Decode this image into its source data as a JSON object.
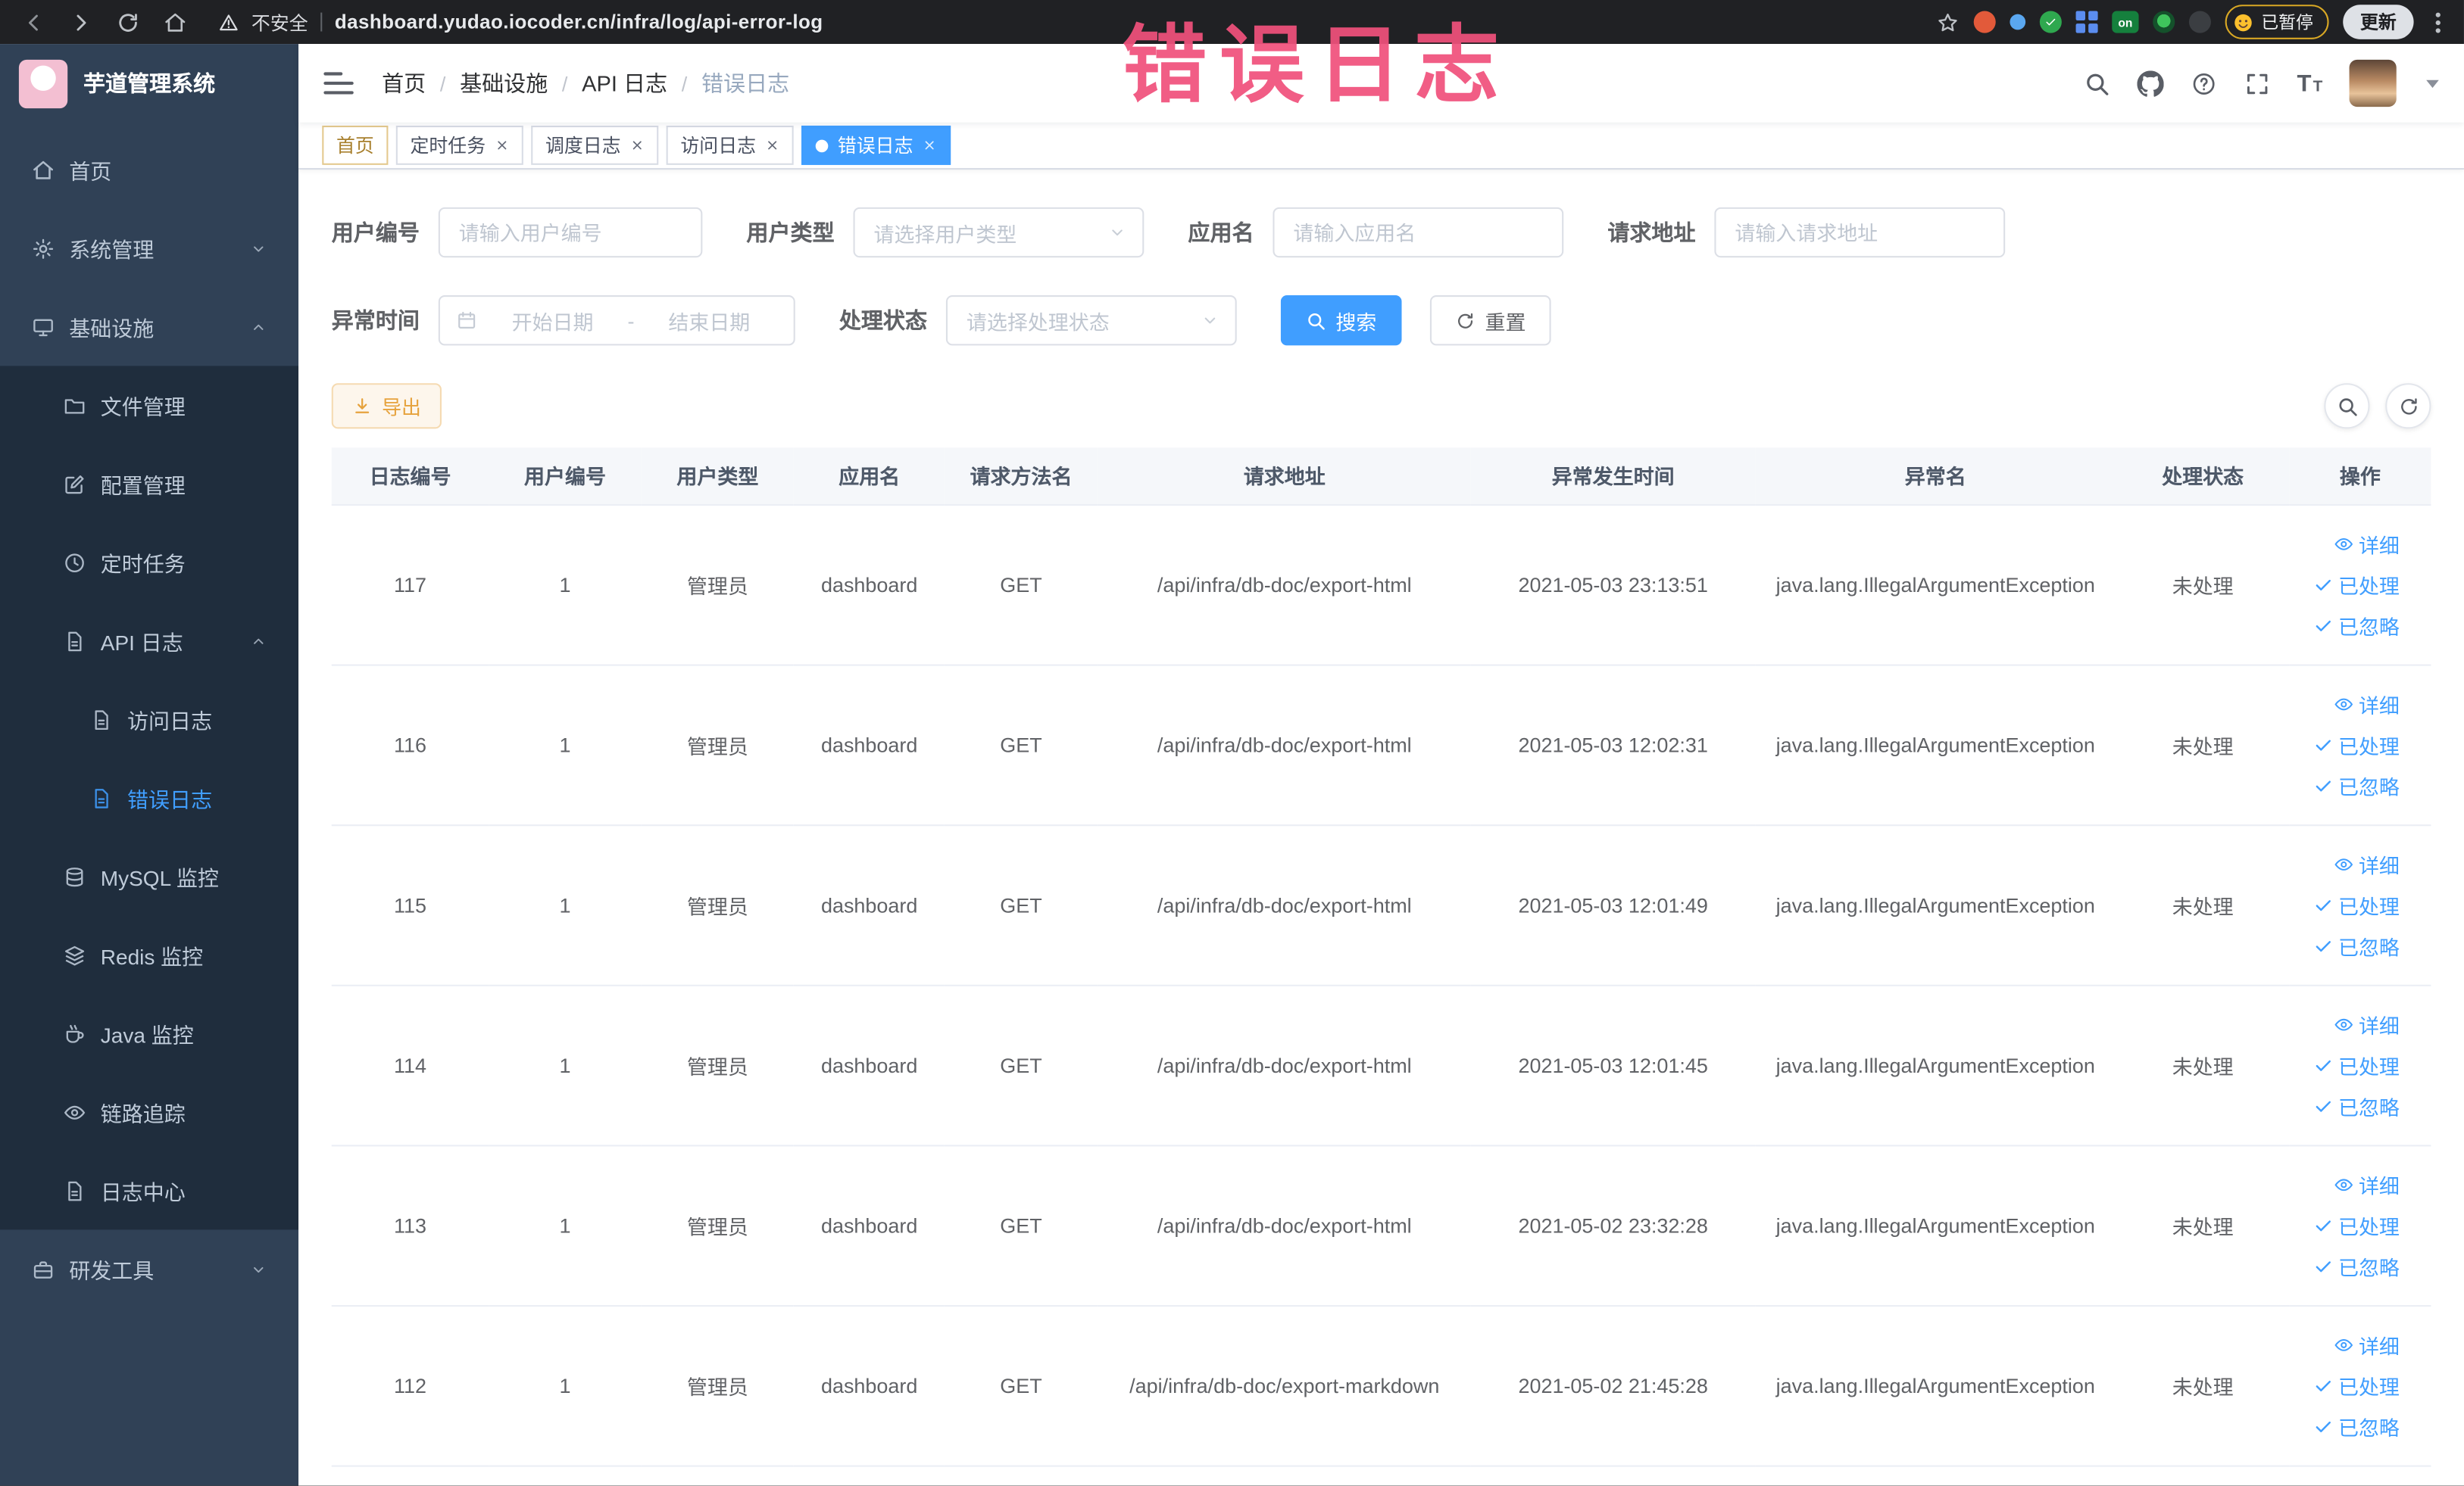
{
  "browser": {
    "security_label": "不安全",
    "url": "dashboard.yudao.iocoder.cn/infra/log/api-error-log",
    "on_badge_label": "on",
    "paused_label": "已暂停",
    "update_label": "更新"
  },
  "stamp_text": "错误日志",
  "sidebar": {
    "logo_title": "芋道管理系统",
    "items": {
      "home": "首页",
      "system_mgmt": "系统管理",
      "infrastructure": "基础设施",
      "file_mgmt": "文件管理",
      "config_mgmt": "配置管理",
      "scheduled_jobs": "定时任务",
      "api_log": "API 日志",
      "access_log": "访问日志",
      "error_log": "错误日志",
      "mysql_monitor": "MySQL 监控",
      "redis_monitor": "Redis 监控",
      "java_monitor": "Java 监控",
      "trace": "链路追踪",
      "log_center": "日志中心",
      "dev_tools": "研发工具"
    }
  },
  "topbar": {
    "breadcrumb": [
      "首页",
      "基础设施",
      "API 日志",
      "错误日志"
    ],
    "breadcrumb_separator": "/"
  },
  "tabs": [
    {
      "label": "首页"
    },
    {
      "label": "定时任务"
    },
    {
      "label": "调度日志"
    },
    {
      "label": "访问日志"
    },
    {
      "label": "错误日志"
    }
  ],
  "filters": {
    "user_id": {
      "label": "用户编号",
      "placeholder": "请输入用户编号",
      "value": ""
    },
    "user_type": {
      "label": "用户类型",
      "placeholder": "请选择用户类型"
    },
    "app_name": {
      "label": "应用名",
      "placeholder": "请输入应用名",
      "value": ""
    },
    "request_url": {
      "label": "请求地址",
      "placeholder": "请输入请求地址",
      "value": ""
    },
    "exception_time": {
      "label": "异常时间",
      "start_placeholder": "开始日期",
      "separator": "-",
      "end_placeholder": "结束日期"
    },
    "process_status": {
      "label": "处理状态",
      "placeholder": "请选择处理状态"
    },
    "search_label": "搜索",
    "reset_label": "重置"
  },
  "toolbar": {
    "export_label": "导出"
  },
  "table": {
    "headers": [
      "日志编号",
      "用户编号",
      "用户类型",
      "应用名",
      "请求方法名",
      "请求地址",
      "异常发生时间",
      "异常名",
      "处理状态",
      "操作"
    ],
    "actions": [
      "详细",
      "已处理",
      "已忽略"
    ],
    "rows": [
      {
        "cells": [
          "117",
          "1",
          "管理员",
          "dashboard",
          "GET",
          "/api/infra/db-doc/export-html",
          "2021-05-03 23:13:51",
          "java.lang.IllegalArgumentException",
          "未处理"
        ]
      },
      {
        "cells": [
          "116",
          "1",
          "管理员",
          "dashboard",
          "GET",
          "/api/infra/db-doc/export-html",
          "2021-05-03 12:02:31",
          "java.lang.IllegalArgumentException",
          "未处理"
        ]
      },
      {
        "cells": [
          "115",
          "1",
          "管理员",
          "dashboard",
          "GET",
          "/api/infra/db-doc/export-html",
          "2021-05-03 12:01:49",
          "java.lang.IllegalArgumentException",
          "未处理"
        ]
      },
      {
        "cells": [
          "114",
          "1",
          "管理员",
          "dashboard",
          "GET",
          "/api/infra/db-doc/export-html",
          "2021-05-03 12:01:45",
          "java.lang.IllegalArgumentException",
          "未处理"
        ]
      },
      {
        "cells": [
          "113",
          "1",
          "管理员",
          "dashboard",
          "GET",
          "/api/infra/db-doc/export-html",
          "2021-05-02 23:32:28",
          "java.lang.IllegalArgumentException",
          "未处理"
        ]
      },
      {
        "cells": [
          "112",
          "1",
          "管理员",
          "dashboard",
          "GET",
          "/api/infra/db-doc/export-markdown",
          "2021-05-02 21:45:28",
          "java.lang.IllegalArgumentException",
          "未处理"
        ]
      }
    ]
  },
  "colors": {
    "primary": "#409eff",
    "warning": "#e6a23c",
    "stamp_pink": "#f0517c",
    "sidebar_bg": "#304156",
    "submenu_bg": "#1f2d3d",
    "active_tab_bg": "#409eff"
  },
  "icons": {
    "back-icon": "‹",
    "forward-icon": "›",
    "reload-icon": "⟳",
    "home-icon": "⌂",
    "warning-icon": "!",
    "star-icon": "☆",
    "browser-menu-icon": "⋮",
    "hamburger-icon": "☰",
    "search-icon": "Q",
    "help-icon": "?",
    "fullscreen-icon": "[]",
    "font-size-icon": "T",
    "caret-down-icon": "▾",
    "calendar-icon": "▦",
    "download-icon": "↓",
    "refresh-icon": "⟳",
    "close-icon": "×",
    "eye-icon": "◎",
    "check-icon": "✓",
    "active-tab-dot": "●"
  }
}
